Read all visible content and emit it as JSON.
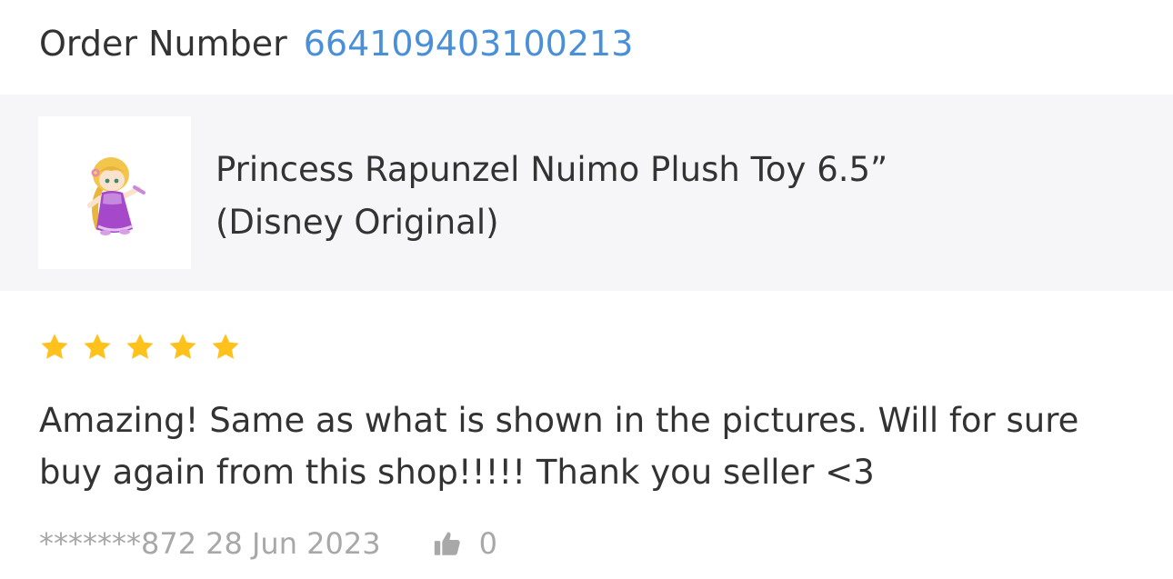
{
  "order": {
    "label": "Order Number",
    "number": "664109403100213"
  },
  "product": {
    "title_line1": "Princess Rapunzel Nuimo Plush Toy 6.5”",
    "title_line2": "(Disney Original)",
    "thumbnail_icon": "rapunzel-plush-image"
  },
  "review": {
    "rating": 5,
    "max_rating": 5,
    "star_color": "#ffc21d",
    "text_line1": "Amazing! Same as what is shown in the pictures. Will for sure",
    "text_line2": "buy again from this shop!!!!! Thank you seller <3",
    "reviewer": "*******872",
    "date": "28 Jun 2023",
    "likes": "0",
    "like_icon": "thumbs-up-icon"
  },
  "colors": {
    "link": "#4a90d9",
    "text": "#333333",
    "muted": "#a8a8a8",
    "band": "#f6f6f8"
  }
}
